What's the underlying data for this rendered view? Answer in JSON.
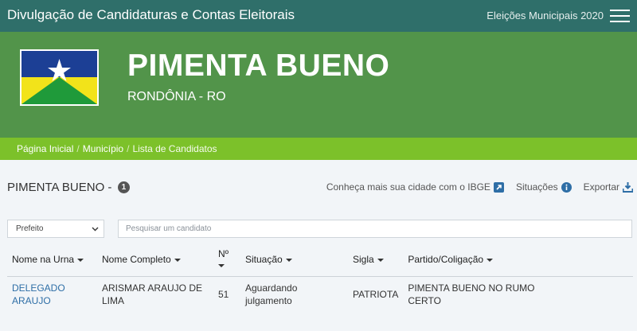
{
  "app": {
    "title": "Divulgação de Candidaturas e Contas Eleitorais",
    "election": "Eleições Municipais 2020"
  },
  "hero": {
    "city": "PIMENTA BUENO",
    "state": "RONDÔNIA - RO",
    "colors": {
      "flag_blue": "#1c3f95",
      "flag_yellow": "#f2e31a",
      "flag_green": "#1f9a3a",
      "star": "#ffffff"
    }
  },
  "breadcrumb": {
    "home": "Página Inicial",
    "municipio": "Município",
    "current": "Lista de Candidatos"
  },
  "content": {
    "title": "PIMENTA BUENO -",
    "count": "1",
    "ibge_link": "Conheça mais sua cidade com o IBGE",
    "situacoes": "Situações",
    "exportar": "Exportar"
  },
  "filters": {
    "cargo": "Prefeito",
    "search_placeholder": "Pesquisar um candidato"
  },
  "table": {
    "headers": {
      "nome_urna": "Nome na Urna",
      "nome_completo": "Nome Completo",
      "numero": "Nº",
      "situacao": "Situação",
      "sigla": "Sigla",
      "partido": "Partido/Coligação"
    },
    "rows": [
      {
        "nome_urna": "DELEGADO ARAUJO",
        "nome_completo": "ARISMAR ARAUJO DE LIMA",
        "numero": "51",
        "situacao": "Aguardando julgamento",
        "sigla": "PATRIOTA",
        "partido": "PIMENTA BUENO NO RUMO CERTO"
      }
    ]
  },
  "colors": {
    "topbar": "#2f6f6a",
    "hero": "#52944a",
    "breadcrumb_bar": "#7cc12a",
    "link": "#2e6ea6",
    "icon": "#2e6ea6"
  }
}
